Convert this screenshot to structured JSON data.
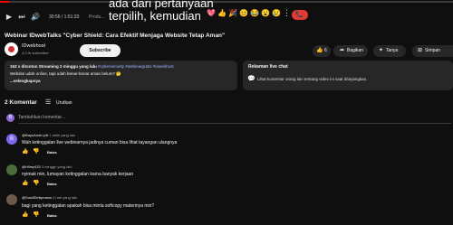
{
  "player": {
    "progress_fraction": 0.02,
    "time": "30:56 / 1:51:33",
    "live": "Produ...",
    "overlay_caption": "ada dari pertanyaan terpilih, kemudian",
    "icons": [
      "play-icon",
      "volume-icon",
      "cc-icon"
    ],
    "reactions": [
      "💖",
      "👍",
      "🎉",
      "😊",
      "😂",
      "😮",
      "😢",
      "✊"
    ],
    "more": "⋮",
    "hang_icon": "📞"
  },
  "video": {
    "title": "Webinar IDwebTalks \"Cyber Shield: Cara Efektif Menjaga Website Tetap Aman\"",
    "channel_name": "IDwebhost",
    "channel_subs": "4,2 rb subscriber",
    "subscribe_label": "Subscribe"
  },
  "actions": {
    "like_count": "6",
    "share_label": "Bagikan",
    "ask_label": "Tanya",
    "save_label": "Simpan"
  },
  "description": {
    "meta": "153 x ditonton  Streaming 2 minggu yang lalu",
    "tags": "#cybersecurity #webinargratis #idwebhost",
    "body": "Website udah online, tapi udah benar-benar aman belum? 🤔",
    "more": "...selengkapnya"
  },
  "chat": {
    "title": "Rekaman live chat",
    "subtitle": "Lihat komentar orang lain tentang video ini saat ditayangkan."
  },
  "comments_header": {
    "count_label": "2 Komentar",
    "sort_label": "Urutkan",
    "add_placeholder": "Tambahkan komentar...",
    "my_initial": "B"
  },
  "comments": [
    {
      "initial": "B",
      "author": "@BayuAndri-y4t",
      "time": "1 detik yang lalu",
      "text": "Wah ketinggalan live webinarnya jadinya cuman bisa lihat tayangan ulangnya",
      "reply": "Balas",
      "avatar_color": "#7b68ee"
    },
    {
      "initial": "",
      "author": "@Hilmy433",
      "time": "3 minggu yang lalu",
      "text": "nyimak min, lumayan ketinggalan karna banyak kerjaan",
      "reply": "Balas",
      "avatar_color": "#4a6b3a"
    },
    {
      "initial": "",
      "author": "@SusiliDeliyeusss",
      "time": "4 hari yang lalu",
      "text": "bagi yang ketinggalan apakah bisa minta softcopy materinya min?",
      "reply": "Balas",
      "avatar_color": "#6b5a4a"
    }
  ]
}
